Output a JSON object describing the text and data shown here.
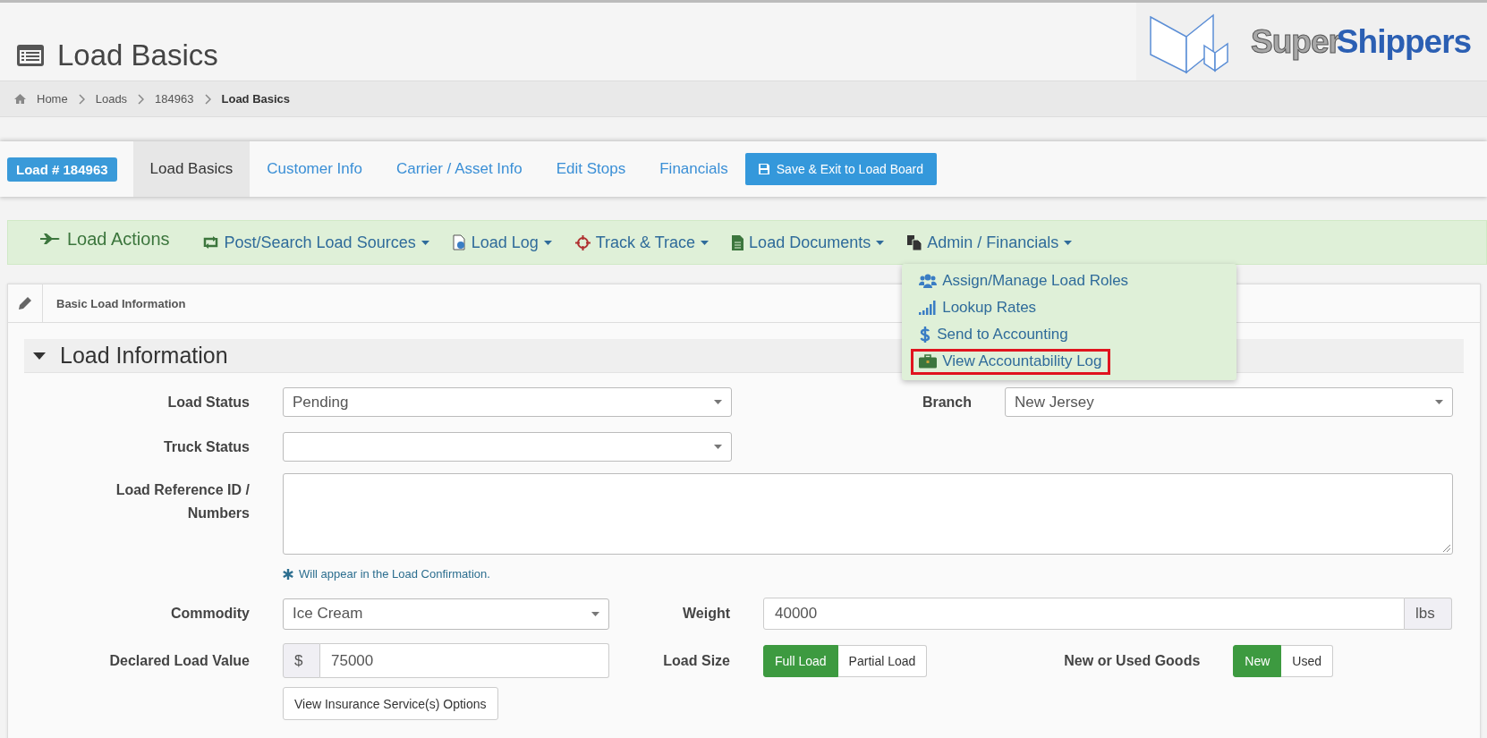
{
  "page_title": "Load Basics",
  "logo": {
    "word_1": "Super",
    "word_2": "Shippers"
  },
  "breadcrumb": [
    {
      "label": "Home",
      "current": false
    },
    {
      "label": "Loads",
      "current": false
    },
    {
      "label": "184963",
      "current": false
    },
    {
      "label": "Load Basics",
      "current": true
    }
  ],
  "load_badge": "Load # 184963",
  "tabs": [
    {
      "label": "Load Basics",
      "selected": true
    },
    {
      "label": "Customer Info",
      "selected": false
    },
    {
      "label": "Carrier / Asset Info",
      "selected": false
    },
    {
      "label": "Edit Stops",
      "selected": false
    },
    {
      "label": "Financials",
      "selected": false
    }
  ],
  "save_button": "Save & Exit to Load Board",
  "load_actions": {
    "title": "Load Actions",
    "menus": [
      {
        "label": "Post/Search Load Sources"
      },
      {
        "label": "Load Log"
      },
      {
        "label": "Track & Trace"
      },
      {
        "label": "Load Documents"
      },
      {
        "label": "Admin / Financials",
        "items": [
          {
            "label": "Assign/Manage Load Roles",
            "highlighted": false
          },
          {
            "label": "Lookup Rates",
            "highlighted": false
          },
          {
            "label": "Send to Accounting",
            "highlighted": false
          },
          {
            "label": "View Accountability Log",
            "highlighted": true
          }
        ]
      }
    ]
  },
  "panel": {
    "title": "Basic Load Information"
  },
  "section": {
    "title": "Load Information",
    "expanded": true
  },
  "load_status": {
    "label": "Load Status",
    "value": "Pending"
  },
  "branch": {
    "label": "Branch",
    "value": "New Jersey"
  },
  "truck_status": {
    "label": "Truck Status"
  },
  "load_reference": {
    "label": "Load Reference ID / Numbers",
    "hint": "Will appear in the Load Confirmation."
  },
  "commodity": {
    "label": "Commodity",
    "value": "Ice Cream"
  },
  "weight": {
    "label": "Weight",
    "value": "40000",
    "unit": "lbs"
  },
  "declared_value": {
    "label": "Declared Load Value",
    "prefix": "$",
    "value": "75000"
  },
  "load_size": {
    "label": "Load Size",
    "options": [
      {
        "label": "Full Load",
        "selected": true
      },
      {
        "label": "Partial Load",
        "selected": false
      }
    ]
  },
  "goods_condition": {
    "label": "New or Used Goods",
    "options": [
      {
        "label": "New",
        "selected": true
      },
      {
        "label": "Used",
        "selected": false
      }
    ]
  },
  "insurance_button": "View Insurance Service(s) Options"
}
